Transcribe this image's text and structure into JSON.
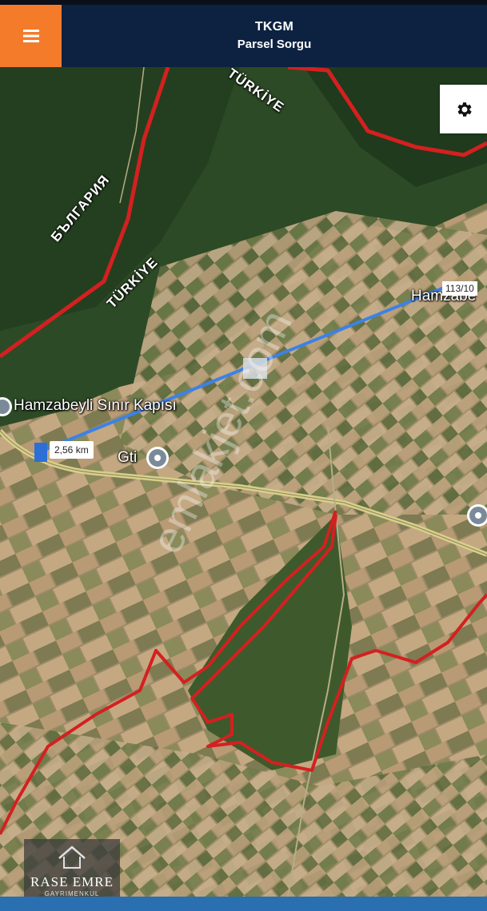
{
  "header": {
    "title": "TKGM",
    "subtitle": "Parsel Sorgu"
  },
  "icons": {
    "menu": "hamburger-icon",
    "settings": "gear-icon",
    "place_marker": "map-pin-icon"
  },
  "map": {
    "labels": {
      "border_bg": "БЪЛГАРИЯ",
      "border_tr": "TÜRKİYE",
      "border_tr_top": "TÜRKİYE",
      "crossing": "Hamzabeyli Sınır Kapısı",
      "gti": "Gti",
      "village": "Hamzabe"
    },
    "distance": "2,56 km",
    "parcel": "113/10",
    "watermark": "emlakjet.com"
  },
  "logo": {
    "name": "RASE EMRE",
    "sub": "GAYRIMENKUL"
  },
  "colors": {
    "header_bg": "#0d2240",
    "menu_bg": "#f47b2a",
    "border_line": "#d42020",
    "measure_line": "#3b82e6"
  }
}
